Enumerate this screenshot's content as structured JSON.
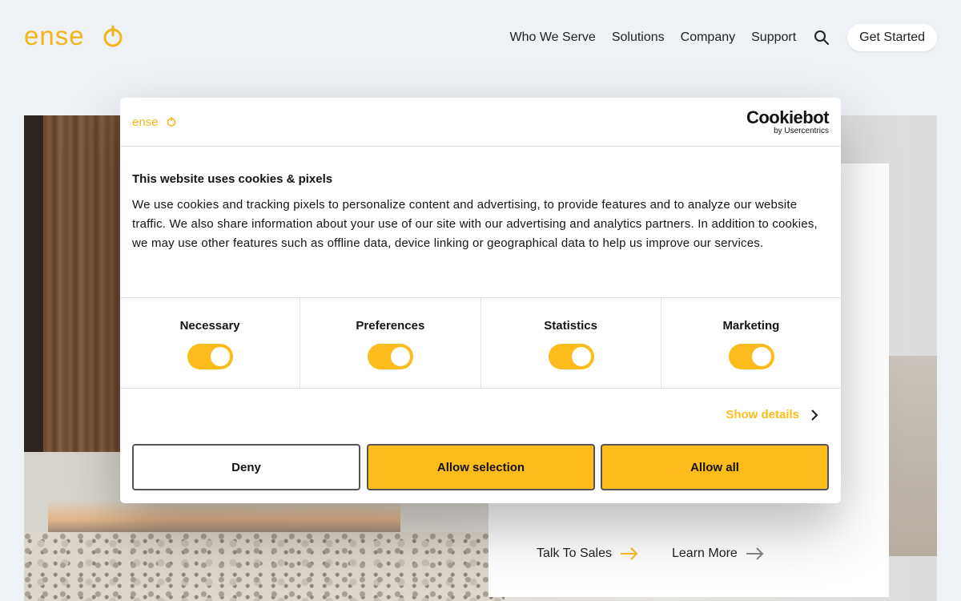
{
  "header": {
    "logo_text": "enseo",
    "nav": [
      "Who We Serve",
      "Solutions",
      "Company",
      "Support"
    ],
    "get_started": "Get Started",
    "search_icon": "search-icon"
  },
  "hero": {
    "links": [
      "Talk To Sales",
      "Learn More"
    ]
  },
  "cookie_dialog": {
    "logo_text": "enseo",
    "brand": "Cookiebot",
    "brand_sub": "by Usercentrics",
    "title": "This website uses cookies & pixels",
    "body": "We use cookies and tracking pixels to personalize content and advertising, to provide features and to analyze our website traffic. We also share information about your use of our site with our advertising and analytics partners. In addition to cookies, we may use other features such as offline data, device linking or geographical data to help us improve our services.",
    "categories": [
      {
        "label": "Necessary",
        "enabled": true
      },
      {
        "label": "Preferences",
        "enabled": true
      },
      {
        "label": "Statistics",
        "enabled": true
      },
      {
        "label": "Marketing",
        "enabled": true
      }
    ],
    "show_details": "Show details",
    "buttons": {
      "deny": "Deny",
      "allow_selection": "Allow selection",
      "allow_all": "Allow all"
    }
  },
  "colors": {
    "accent": "#fdbc1b",
    "page_bg": "#eef1f5",
    "text": "#141414"
  }
}
